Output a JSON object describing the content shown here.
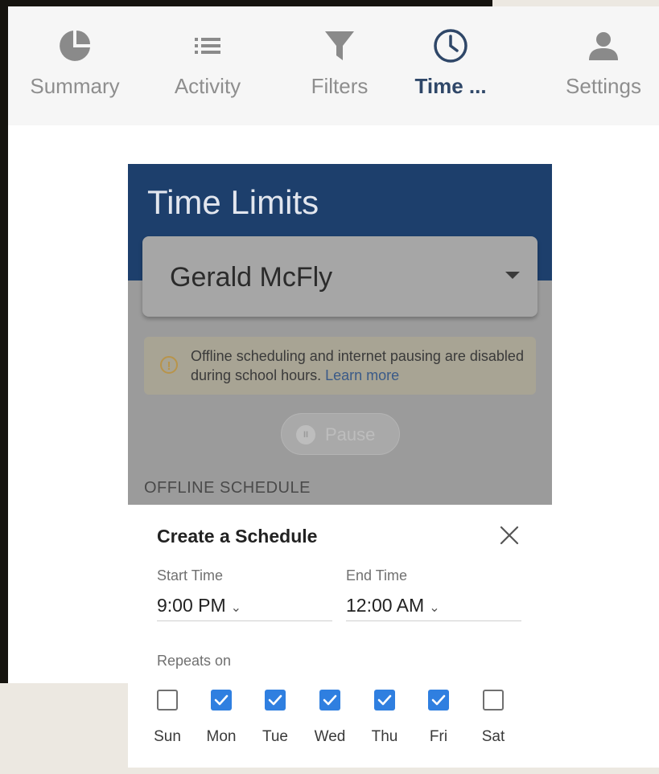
{
  "nav": {
    "items": [
      {
        "label": "Summary",
        "icon": "pie-chart-icon",
        "active": false
      },
      {
        "label": "Activity",
        "icon": "list-icon",
        "active": false
      },
      {
        "label": "Filters",
        "icon": "filter-icon",
        "active": false
      },
      {
        "label": "Time ...",
        "icon": "clock-icon",
        "active": true
      },
      {
        "label": "Settings",
        "icon": "person-icon",
        "active": false
      }
    ]
  },
  "screen": {
    "title": "Time Limits",
    "profile_selector": {
      "value": "Gerald McFly"
    },
    "notice": {
      "text": "Offline scheduling and internet pausing are disabled during school hours.",
      "link": "Learn more"
    },
    "pause_label": "Pause",
    "section_label": "OFFLINE SCHEDULE"
  },
  "schedule": {
    "title": "Create a Schedule",
    "start_label": "Start Time",
    "start_value": "9:00 PM",
    "end_label": "End Time",
    "end_value": "12:00 AM",
    "repeats_label": "Repeats on",
    "days": [
      {
        "label": "Sun",
        "checked": false
      },
      {
        "label": "Mon",
        "checked": true
      },
      {
        "label": "Tue",
        "checked": true
      },
      {
        "label": "Wed",
        "checked": true
      },
      {
        "label": "Thu",
        "checked": true
      },
      {
        "label": "Fri",
        "checked": true
      },
      {
        "label": "Sat",
        "checked": false
      }
    ]
  },
  "colors": {
    "header": "#1d3f6c",
    "active_tab": "#2f4768",
    "checkbox": "#2f7fe0"
  }
}
